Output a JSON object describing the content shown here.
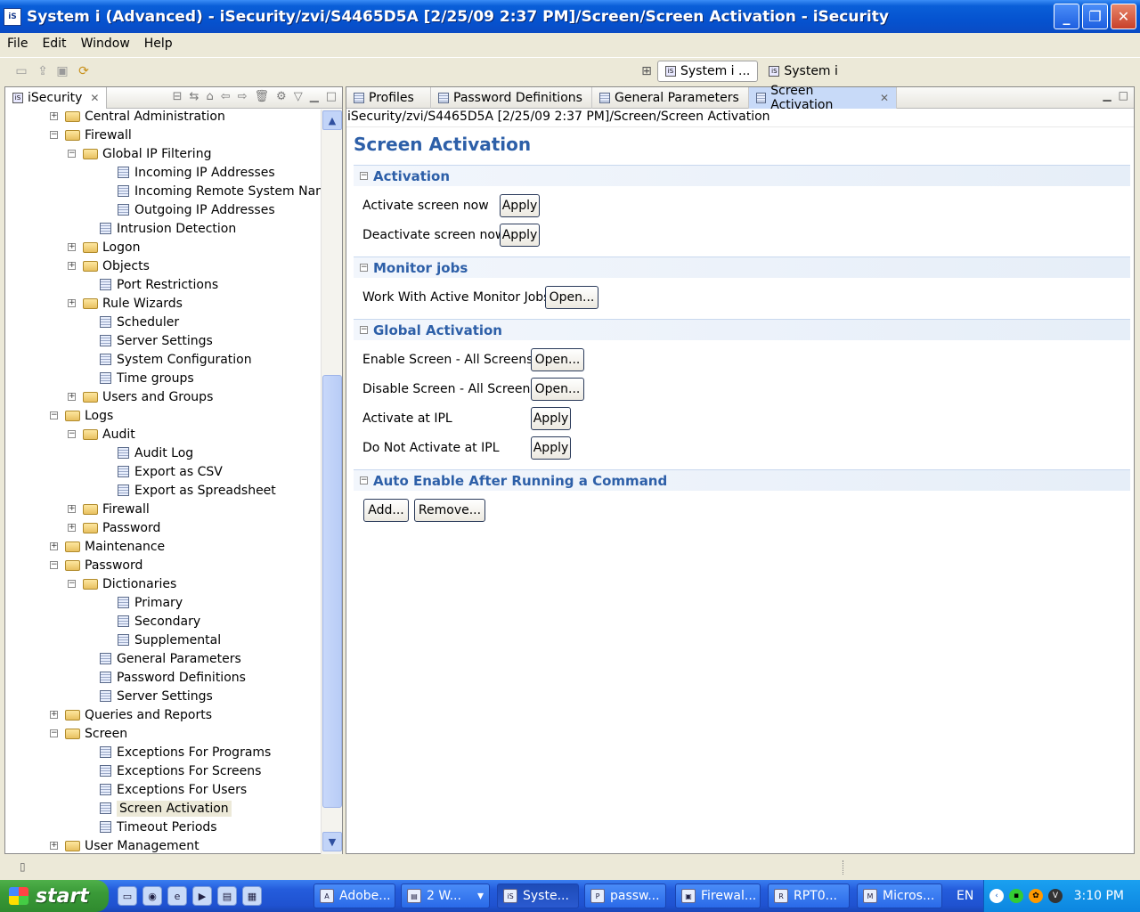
{
  "window": {
    "title": "System i (Advanced) - iSecurity/zvi/S4465D5A [2/25/09 2:37 PM]/Screen/Screen Activation - iSecurity",
    "app_icon": "iS",
    "minimize": "_",
    "maximize": "❐",
    "close": "✕"
  },
  "menu": [
    "File",
    "Edit",
    "Window",
    "Help"
  ],
  "perspectives": [
    {
      "label": "System i ...",
      "active": true
    },
    {
      "label": "System i",
      "active": false
    }
  ],
  "navigator": {
    "tab_label": "iSecurity",
    "tree": [
      {
        "label": "Central Administration",
        "level": 0,
        "type": "folder",
        "expander": "+"
      },
      {
        "label": "Firewall",
        "level": 0,
        "type": "folder",
        "expander": "−"
      },
      {
        "label": "Global IP Filtering",
        "level": 1,
        "type": "folder",
        "expander": "−"
      },
      {
        "label": "Incoming IP Addresses",
        "level": 2,
        "type": "doc"
      },
      {
        "label": "Incoming Remote System Names",
        "level": 2,
        "type": "doc"
      },
      {
        "label": "Outgoing IP Addresses",
        "level": 2,
        "type": "doc"
      },
      {
        "label": "Intrusion Detection",
        "level": 1,
        "type": "doc"
      },
      {
        "label": "Logon",
        "level": 1,
        "type": "folder",
        "expander": "+"
      },
      {
        "label": "Objects",
        "level": 1,
        "type": "folder",
        "expander": "+"
      },
      {
        "label": "Port Restrictions",
        "level": 1,
        "type": "doc"
      },
      {
        "label": "Rule Wizards",
        "level": 1,
        "type": "folder",
        "expander": "+"
      },
      {
        "label": "Scheduler",
        "level": 1,
        "type": "doc"
      },
      {
        "label": "Server Settings",
        "level": 1,
        "type": "doc"
      },
      {
        "label": "System Configuration",
        "level": 1,
        "type": "doc"
      },
      {
        "label": "Time groups",
        "level": 1,
        "type": "doc"
      },
      {
        "label": "Users and Groups",
        "level": 1,
        "type": "folder",
        "expander": "+"
      },
      {
        "label": "Logs",
        "level": 0,
        "type": "folder",
        "expander": "−"
      },
      {
        "label": "Audit",
        "level": 1,
        "type": "folder",
        "expander": "−"
      },
      {
        "label": "Audit Log",
        "level": 2,
        "type": "doc"
      },
      {
        "label": "Export as CSV",
        "level": 2,
        "type": "doc"
      },
      {
        "label": "Export as Spreadsheet",
        "level": 2,
        "type": "doc"
      },
      {
        "label": "Firewall",
        "level": 1,
        "type": "folder",
        "expander": "+"
      },
      {
        "label": "Password",
        "level": 1,
        "type": "folder",
        "expander": "+"
      },
      {
        "label": "Maintenance",
        "level": 0,
        "type": "folder",
        "expander": "+"
      },
      {
        "label": "Password",
        "level": 0,
        "type": "folder",
        "expander": "−"
      },
      {
        "label": "Dictionaries",
        "level": 1,
        "type": "folder",
        "expander": "−"
      },
      {
        "label": "Primary",
        "level": 2,
        "type": "doc"
      },
      {
        "label": "Secondary",
        "level": 2,
        "type": "doc"
      },
      {
        "label": "Supplemental",
        "level": 2,
        "type": "doc"
      },
      {
        "label": "General Parameters",
        "level": 1,
        "type": "doc"
      },
      {
        "label": "Password Definitions",
        "level": 1,
        "type": "doc"
      },
      {
        "label": "Server Settings",
        "level": 1,
        "type": "doc"
      },
      {
        "label": "Queries and Reports",
        "level": 0,
        "type": "folder",
        "expander": "+"
      },
      {
        "label": "Screen",
        "level": 0,
        "type": "folder",
        "expander": "−"
      },
      {
        "label": "Exceptions For Programs",
        "level": 1,
        "type": "doc"
      },
      {
        "label": "Exceptions For Screens",
        "level": 1,
        "type": "doc"
      },
      {
        "label": "Exceptions For Users",
        "level": 1,
        "type": "doc"
      },
      {
        "label": "Screen Activation",
        "level": 1,
        "type": "doc",
        "selected": true
      },
      {
        "label": "Timeout Periods",
        "level": 1,
        "type": "doc"
      },
      {
        "label": "User Management",
        "level": 0,
        "type": "folder",
        "expander": "+"
      }
    ]
  },
  "editor": {
    "tabs": [
      {
        "label": "Profiles",
        "active": false
      },
      {
        "label": "Password Definitions",
        "active": false
      },
      {
        "label": "General Parameters",
        "active": false
      },
      {
        "label": "Screen Activation",
        "active": true
      }
    ],
    "path": "iSecurity/zvi/S4465D5A [2/25/09 2:37 PM]/Screen/Screen Activation",
    "page_title": "Screen Activation",
    "sections": {
      "activation": {
        "title": "Activation",
        "activate_label": "Activate screen now",
        "activate_btn": "Apply",
        "deactivate_label": "Deactivate screen now",
        "deactivate_btn": "Apply"
      },
      "monitor": {
        "title": "Monitor jobs",
        "work_label": "Work With Active Monitor Jobs",
        "work_btn": "Open..."
      },
      "global": {
        "title": "Global Activation",
        "enable_label": "Enable Screen - All Screens",
        "enable_btn": "Open...",
        "disable_label": "Disable Screen - All Screens",
        "disable_btn": "Open...",
        "ipl_label": "Activate at IPL",
        "ipl_btn": "Apply",
        "noipl_label": "Do Not Activate at IPL",
        "noipl_btn": "Apply"
      },
      "auto": {
        "title": "Auto Enable After Running a Command",
        "add_btn": "Add...",
        "remove_btn": "Remove..."
      }
    }
  },
  "taskbar": {
    "start": "start",
    "tasks": [
      "Adobe...",
      "2 W...",
      "Syste...",
      "passw...",
      "Firewal...",
      "RPT0...",
      "Micros..."
    ],
    "lang": "EN",
    "clock": "3:10 PM"
  }
}
